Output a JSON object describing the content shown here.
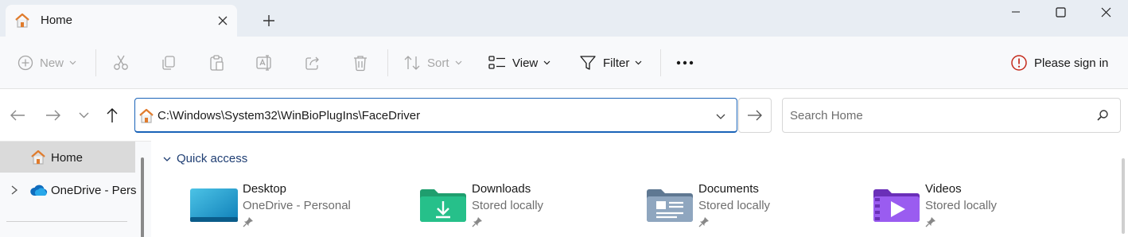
{
  "tab": {
    "title": "Home"
  },
  "toolbar": {
    "new_label": "New",
    "sort_label": "Sort",
    "view_label": "View",
    "filter_label": "Filter",
    "sign_in_label": "Please sign in"
  },
  "address": {
    "path": "C:\\Windows\\System32\\WinBioPlugIns\\FaceDriver"
  },
  "search": {
    "placeholder": "Search Home"
  },
  "nav": {
    "home_label": "Home",
    "onedrive_label": "OneDrive - Personal"
  },
  "quick_access": {
    "label": "Quick access",
    "folders": [
      {
        "name": "Desktop",
        "sub": "OneDrive - Personal"
      },
      {
        "name": "Downloads",
        "sub": "Stored locally"
      },
      {
        "name": "Documents",
        "sub": "Stored locally"
      },
      {
        "name": "Videos",
        "sub": "Stored locally"
      }
    ]
  },
  "colors": {
    "accent": "#1a63b8",
    "titlebar": "#e8edf3",
    "sign_in_warning": "#c42b1c"
  },
  "icons": [
    "home-icon",
    "close-icon",
    "plus-icon",
    "minimize-icon",
    "maximize-icon",
    "window-close-icon",
    "new-icon",
    "cut-icon",
    "copy-icon",
    "paste-icon",
    "rename-icon",
    "share-icon",
    "delete-icon",
    "sort-icon",
    "view-icon",
    "filter-icon",
    "more-icon",
    "warning-icon",
    "back-arrow-icon",
    "forward-arrow-icon",
    "recent-chevron-icon",
    "up-arrow-icon",
    "go-arrow-icon",
    "search-icon",
    "onedrive-icon",
    "pin-icon"
  ]
}
